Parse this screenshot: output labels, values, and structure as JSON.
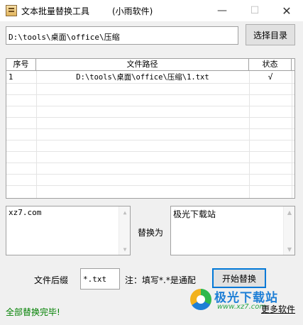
{
  "window": {
    "title": "文本批量替换工具",
    "subtitle": "(小雨软件)",
    "minimize": "—",
    "maximize": "☐",
    "close": "✕"
  },
  "path": {
    "value": "D:\\tools\\桌面\\office\\压缩",
    "choose_button": "选择目录"
  },
  "table": {
    "columns": [
      "序号",
      "文件路径",
      "状态"
    ],
    "rows": [
      {
        "no": "1",
        "path": "D:\\tools\\桌面\\office\\压缩\\1.txt",
        "status": "√"
      }
    ]
  },
  "replace": {
    "find_text": "xz7.com",
    "label": "替换为",
    "replace_text": "极光下载站"
  },
  "options": {
    "suffix_label": "文件后缀",
    "suffix_value": "*.txt",
    "note": "注：填写*.*是通配",
    "start_button": "开始替换"
  },
  "status": {
    "text": "全部替换完毕!"
  },
  "footer": {
    "brand_name": "极光下载站",
    "brand_url": "www.xz7.com",
    "more_link": "更多软件"
  },
  "colors": {
    "status_green": "#008000",
    "brand_blue": "#1e7fd6",
    "focus_border": "#0078d7"
  }
}
